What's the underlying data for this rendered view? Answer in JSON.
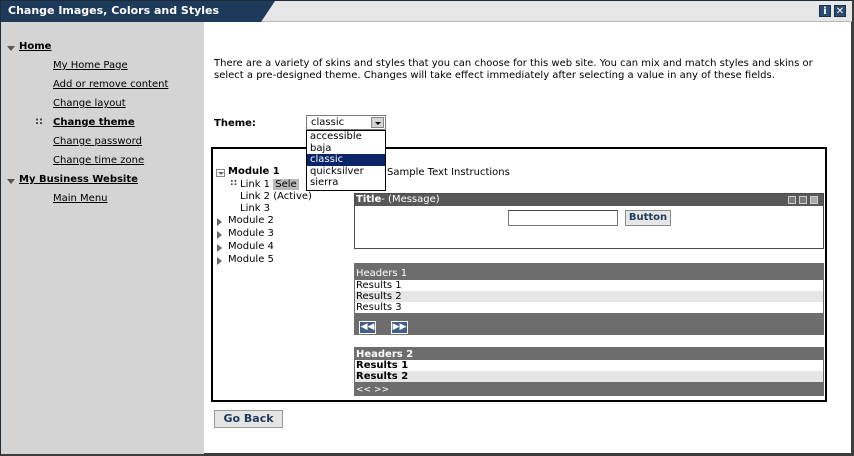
{
  "window": {
    "title": "Change Images, Colors and Styles",
    "info_icon": "i",
    "close_icon": "✕"
  },
  "sidebar": {
    "sections": [
      {
        "label": "Home",
        "items": [
          "My Home Page",
          "Add or remove content",
          "Change layout",
          "Change theme",
          "Change password",
          "Change time zone"
        ]
      },
      {
        "label": "My Business Website",
        "items": [
          "Main Menu"
        ]
      }
    ],
    "active_item": "Change theme"
  },
  "main": {
    "intro": "There are a variety of skins and styles that you can choose for this web site. You can mix and match styles and skins or select a pre-designed theme. Changes will take effect immediately after selecting a value in any of these fields.",
    "theme_label": "Theme:",
    "theme_value": "classic",
    "theme_options": [
      "accessible",
      "baja",
      "classic",
      "quicksilver",
      "sierra"
    ],
    "go_back": "Go Back"
  },
  "preview": {
    "modules": [
      "Module 1",
      "Module 2",
      "Module 3",
      "Module 4",
      "Module 5"
    ],
    "links": [
      "Link 1",
      "Link 2 (Active)",
      "Link 3"
    ],
    "selected_tag": "Sele",
    "instructions": "Sample Text Instructions",
    "portlet_title": "Title",
    "portlet_message": "- (Message)",
    "portlet_button": "Button",
    "table1": {
      "header": "Headers 1",
      "rows": [
        "Results 1",
        "Results 2",
        "Results 3"
      ],
      "prev": "◀◀",
      "next": "▶▶"
    },
    "table2": {
      "header": "Headers 2",
      "rows": [
        "Results 1",
        "Results 2"
      ],
      "pager": "<< >>"
    }
  }
}
